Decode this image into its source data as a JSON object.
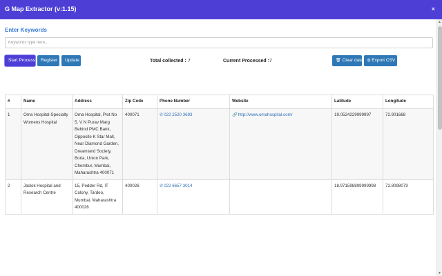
{
  "app": {
    "title": "G Map Extractor (v:1.15)",
    "close_icon": "×"
  },
  "keywords": {
    "label": "Enter Keywords",
    "placeholder": "Keywords type here...",
    "value": ""
  },
  "toolbar": {
    "start_label": "Start Process",
    "register_label": "Register",
    "update_label": "Update",
    "clear_label": "Clear data",
    "export_label": "Export CSV",
    "clear_icon": "trash-icon",
    "export_icon": "export-icon"
  },
  "stats": {
    "total_label": "Total collected :",
    "total_value": "7",
    "processed_label": "Current Processed :",
    "processed_value": "7"
  },
  "table": {
    "headers": [
      "#",
      "Name",
      "Address",
      "Zip Code",
      "Phone Number",
      "Website",
      "Latitude",
      "Longitude"
    ],
    "rows": [
      {
        "num": "1",
        "name": "Oma Hospital-Specialty Womens Hospital",
        "address": "Oma Hospital, Plot No 5, V N Purav Marg Behind PMC Bank, Opposite K Star Mall, Near Diamond Garden, Dreamland Society, Boria, Union Park, Chembur, Mumbai, Maharashtra 400071",
        "zip": "400071",
        "phone": "022 2520 3693",
        "website": "http://www.omahospital.com/",
        "latitude": "19.0524229999997",
        "longitude": "72.901668"
      },
      {
        "num": "2",
        "name": "Jaslok Hospital and Research Centre",
        "address": "15, Pedder Rd, IT Colony, Tardeo, Mumbai, Maharashtra 400026",
        "zip": "400026",
        "phone": "022 6657 3014",
        "website": "",
        "latitude": "18.971598899999998",
        "longitude": "72.8098079"
      }
    ]
  },
  "colors": {
    "titlebar": "#4d3fd6",
    "button": "#2e78b7",
    "label": "#3a7bd5"
  }
}
